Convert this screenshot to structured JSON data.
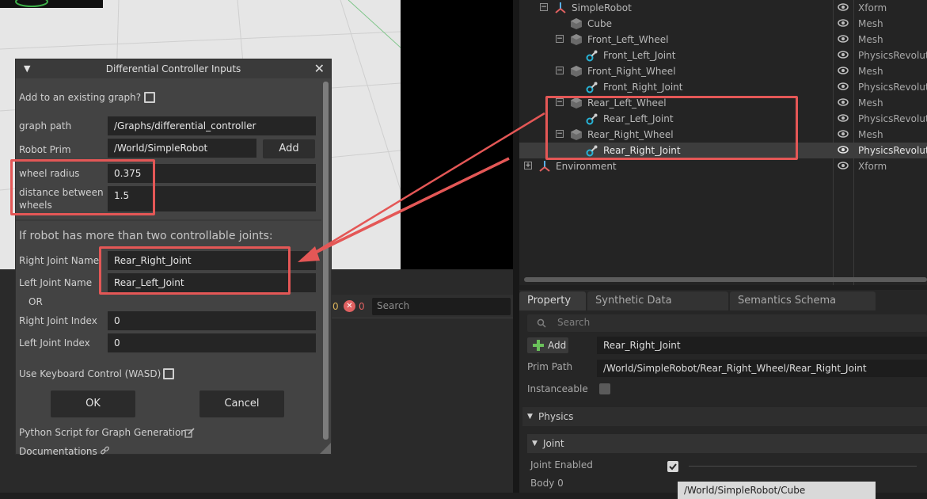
{
  "dialog": {
    "title": "Differential Controller Inputs",
    "add_existing_label": "Add to an existing graph?",
    "graph_path_label": "graph path",
    "graph_path_value": "/Graphs/differential_controller",
    "robot_prim_label": "Robot Prim",
    "robot_prim_value": "/World/SimpleRobot",
    "add_button": "Add",
    "wheel_radius_label": "wheel radius",
    "wheel_radius_value": "0.375",
    "distance_label_line1": "distance between",
    "distance_label_line2": "wheels",
    "distance_value": "1.5",
    "more_joints_heading": "If robot has more than two controllable joints:",
    "right_joint_name_label": "Right Joint Name",
    "right_joint_name_value": "Rear_Right_Joint",
    "left_joint_name_label": "Left Joint Name",
    "left_joint_name_value": "Rear_Left_Joint",
    "or_label": "OR",
    "right_joint_index_label": "Right Joint Index",
    "right_joint_index_value": "0",
    "left_joint_index_label": "Left Joint Index",
    "left_joint_index_value": "0",
    "keyboard_label": "Use Keyboard Control (WASD)",
    "ok_button": "OK",
    "cancel_button": "Cancel",
    "python_script_label": "Python Script for Graph Generation",
    "documentations_label": "Documentations"
  },
  "console": {
    "warn_count": "0",
    "error_count": "0",
    "search_placeholder": "Search"
  },
  "stage": {
    "rows": [
      {
        "name": "SimpleRobot",
        "type": "Xform"
      },
      {
        "name": "Cube",
        "type": "Mesh"
      },
      {
        "name": "Front_Left_Wheel",
        "type": "Mesh"
      },
      {
        "name": "Front_Left_Joint",
        "type": "PhysicsRevolut"
      },
      {
        "name": "Front_Right_Wheel",
        "type": "Mesh"
      },
      {
        "name": "Front_Right_Joint",
        "type": "PhysicsRevolut"
      },
      {
        "name": "Rear_Left_Wheel",
        "type": "Mesh"
      },
      {
        "name": "Rear_Left_Joint",
        "type": "PhysicsRevolut"
      },
      {
        "name": "Rear_Right_Wheel",
        "type": "Mesh"
      },
      {
        "name": "Rear_Right_Joint",
        "type": "PhysicsRevolut"
      },
      {
        "name": "Environment",
        "type": "Xform"
      }
    ]
  },
  "property": {
    "tabs": [
      "Property",
      "Synthetic Data Recorder",
      "Semantics Schema Editor"
    ],
    "search_placeholder": "Search",
    "add_button": "Add",
    "prim_name": "Rear_Right_Joint",
    "prim_path_label": "Prim Path",
    "prim_path_value": "/World/SimpleRobot/Rear_Right_Wheel/Rear_Right_Joint",
    "instanceable_label": "Instanceable",
    "physics_section": "Physics",
    "joint_section": "Joint",
    "joint_enabled_label": "Joint Enabled",
    "body0_label": "Body 0",
    "body0_value": "/World/SimpleRobot/Cube"
  },
  "colors": {
    "highlight": "#e45756",
    "joint_icon": "#27b3d6"
  }
}
